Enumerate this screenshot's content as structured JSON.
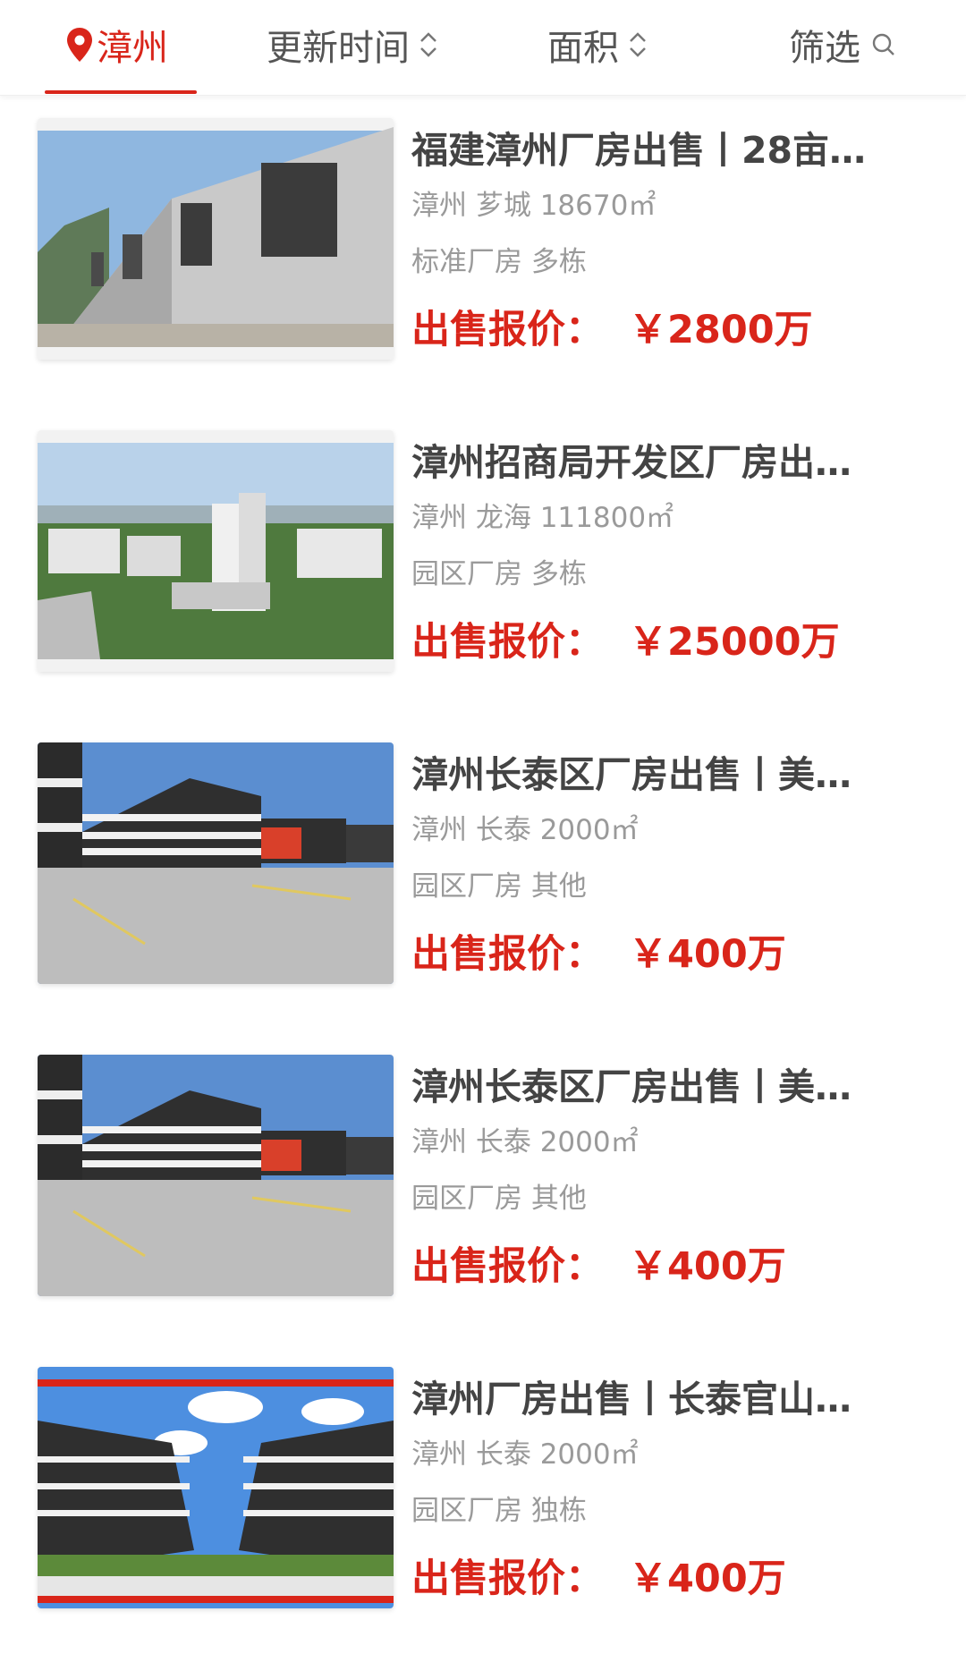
{
  "filter_bar": {
    "location": "漳州",
    "update_time": "更新时间",
    "area": "面积",
    "filter": "筛选"
  },
  "price_label": "出售报价：",
  "listings": [
    {
      "title": "福建漳州厂房出售丨28亩…",
      "location": "漳州 芗城 18670㎡",
      "type": "标准厂房 多栋",
      "price": "￥2800万"
    },
    {
      "title": "漳州招商局开发区厂房出…",
      "location": "漳州 龙海 111800㎡",
      "type": "园区厂房 多栋",
      "price": "￥25000万"
    },
    {
      "title": "漳州长泰区厂房出售丨美…",
      "location": "漳州 长泰 2000㎡",
      "type": "园区厂房 其他",
      "price": "￥400万"
    },
    {
      "title": "漳州长泰区厂房出售丨美…",
      "location": "漳州 长泰 2000㎡",
      "type": "园区厂房 其他",
      "price": "￥400万"
    },
    {
      "title": "漳州厂房出售丨长泰官山…",
      "location": "漳州 长泰 2000㎡",
      "type": "园区厂房 独栋",
      "price": "￥400万"
    }
  ]
}
